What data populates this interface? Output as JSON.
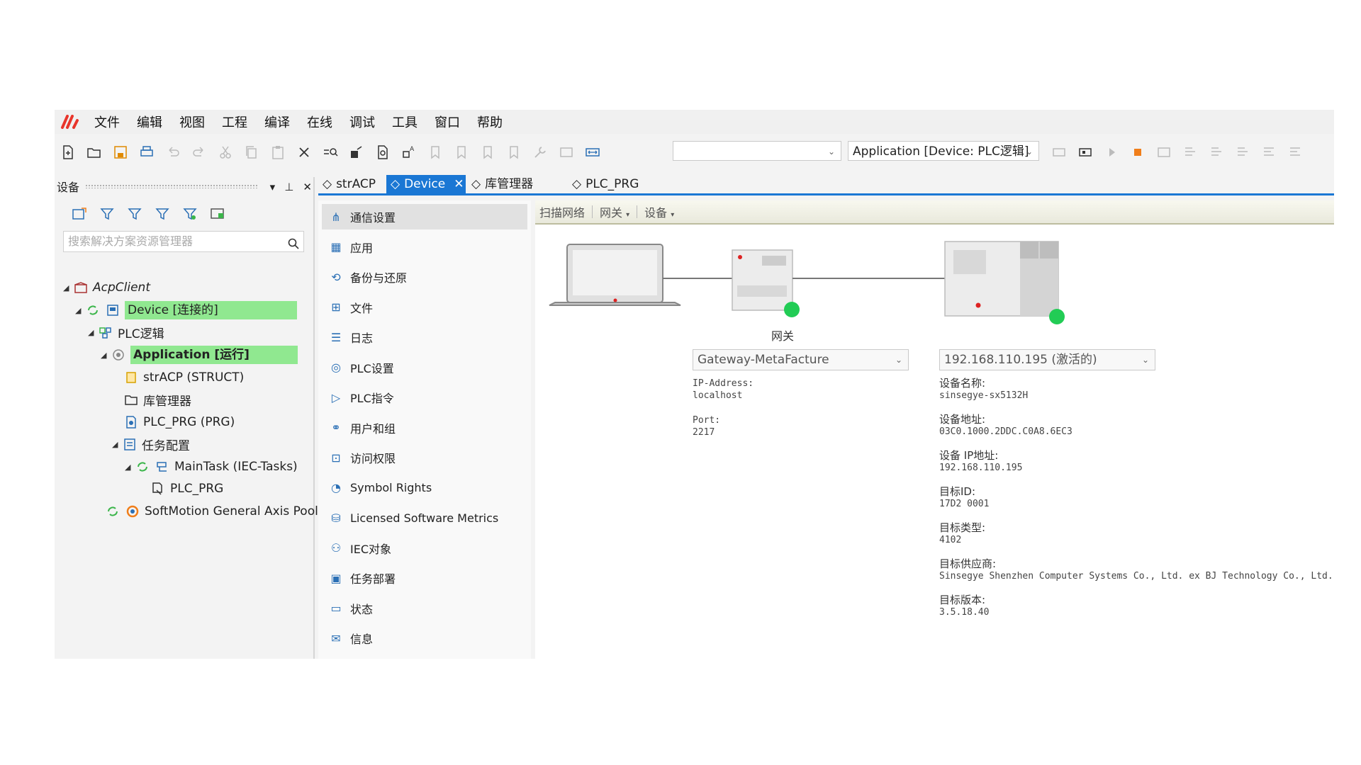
{
  "menu": [
    "文件",
    "编辑",
    "视图",
    "工程",
    "编译",
    "在线",
    "调试",
    "工具",
    "窗口",
    "帮助"
  ],
  "toolbar": {
    "combo1_value": "",
    "combo2_value": "Application [Device: PLC逻辑]"
  },
  "device_panel": {
    "title": "设备",
    "search_placeholder": "搜索解决方案资源管理器",
    "tree": [
      {
        "label": "AcpClient"
      },
      {
        "label": "Device [连接的]"
      },
      {
        "label": "PLC逻辑"
      },
      {
        "label": "Application [运行]"
      },
      {
        "label": "strACP (STRUCT)"
      },
      {
        "label": "库管理器"
      },
      {
        "label": "PLC_PRG (PRG)"
      },
      {
        "label": "任务配置"
      },
      {
        "label": "MainTask (IEC-Tasks)"
      },
      {
        "label": "PLC_PRG"
      },
      {
        "label": "SoftMotion General Axis Pool"
      }
    ]
  },
  "tabs": [
    {
      "label": "strACP"
    },
    {
      "label": "Device"
    },
    {
      "label": "库管理器"
    },
    {
      "label": "PLC_PRG"
    }
  ],
  "nav": [
    {
      "label": "通信设置"
    },
    {
      "label": "应用"
    },
    {
      "label": "备份与还原"
    },
    {
      "label": "文件"
    },
    {
      "label": "日志"
    },
    {
      "label": "PLC设置"
    },
    {
      "label": "PLC指令"
    },
    {
      "label": "用户和组"
    },
    {
      "label": "访问权限"
    },
    {
      "label": "Symbol Rights"
    },
    {
      "label": "Licensed Software Metrics"
    },
    {
      "label": "IEC对象"
    },
    {
      "label": "任务部署"
    },
    {
      "label": "状态"
    },
    {
      "label": "信息"
    }
  ],
  "scanbar": {
    "scan": "扫描网络",
    "gateway": "网关",
    "device": "设备"
  },
  "gateway": {
    "label": "网关",
    "combo_value": "Gateway-MetaFacture",
    "ip_label": "IP-Address:",
    "ip_value": "localhost",
    "port_label": "Port:",
    "port_value": "2217"
  },
  "device": {
    "combo_value": "192.168.110.195 (激活的)",
    "fields": [
      {
        "label": "设备名称:",
        "value": "sinsegye-sx5132H"
      },
      {
        "label": "设备地址:",
        "value": "03C0.1000.2DDC.C0A8.6EC3"
      },
      {
        "label": "设备 IP地址:",
        "value": "192.168.110.195"
      },
      {
        "label": "目标ID:",
        "value": "17D2 0001"
      },
      {
        "label": "目标类型:",
        "value": "4102"
      },
      {
        "label": "目标供应商:",
        "value": "Sinsegye Shenzhen Computer Systems Co., Ltd. ex BJ Technology Co., Ltd."
      },
      {
        "label": "目标版本:",
        "value": "3.5.18.40"
      }
    ]
  },
  "colors": {
    "accent": "#1a77d4",
    "highlight": "#90e890",
    "status_online": "#22cc55",
    "logo_red": "#e8352b"
  }
}
